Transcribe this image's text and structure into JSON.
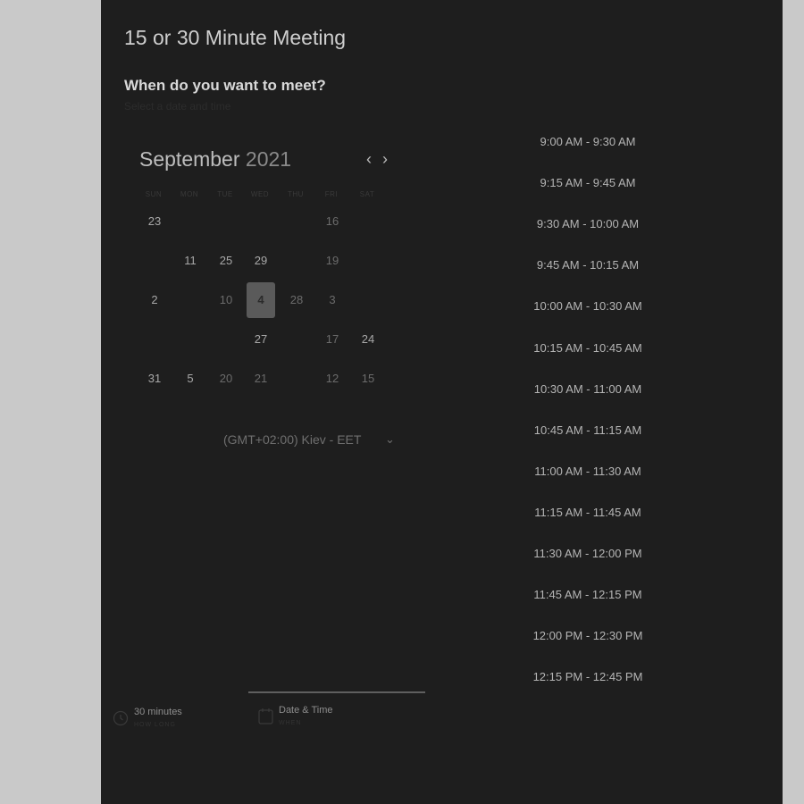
{
  "header": {
    "title": "15 or 30 Minute Meeting",
    "question": "When do you want to meet?",
    "hint": "Select a date and time"
  },
  "calendar": {
    "month": "September",
    "year": "2021",
    "prev_icon": "chevron-left-icon",
    "next_icon": "chevron-right-icon",
    "weekdays": [
      "SUN",
      "MON",
      "TUE",
      "WED",
      "THU",
      "FRI",
      "SAT"
    ],
    "weeks": [
      [
        "23",
        "",
        "",
        "",
        "",
        "16",
        ""
      ],
      [
        "",
        "11",
        "25",
        "29",
        "",
        "19",
        ""
      ],
      [
        "2",
        "",
        "10",
        "4",
        "28",
        "3",
        ""
      ],
      [
        "",
        "",
        "",
        "27",
        "",
        "17",
        "24"
      ],
      [
        "31",
        "5",
        "20",
        "21",
        "",
        "12",
        "15"
      ]
    ],
    "selected_day": "4"
  },
  "timezone": {
    "label": "(GMT+02:00) Kiev - EET",
    "icon": "chevron-down-icon"
  },
  "slots": [
    "9:00 AM - 9:30 AM",
    "9:15 AM - 9:45 AM",
    "9:30 AM - 10:00 AM",
    "9:45 AM - 10:15 AM",
    "10:00 AM - 10:30 AM",
    "10:15 AM - 10:45 AM",
    "10:30 AM - 11:00 AM",
    "10:45 AM - 11:15 AM",
    "11:00 AM - 11:30 AM",
    "11:15 AM - 11:45 AM",
    "11:30 AM - 12:00 PM",
    "11:45 AM - 12:15 PM",
    "12:00 PM - 12:30 PM",
    "12:15 PM - 12:45 PM"
  ],
  "footer": {
    "duration": "30 minutes",
    "duration_sub": "HOW LONG",
    "duration_icon": "clock-icon",
    "datetime": "Date & Time",
    "datetime_sub": "WHEN",
    "datetime_icon": "calendar-icon"
  }
}
